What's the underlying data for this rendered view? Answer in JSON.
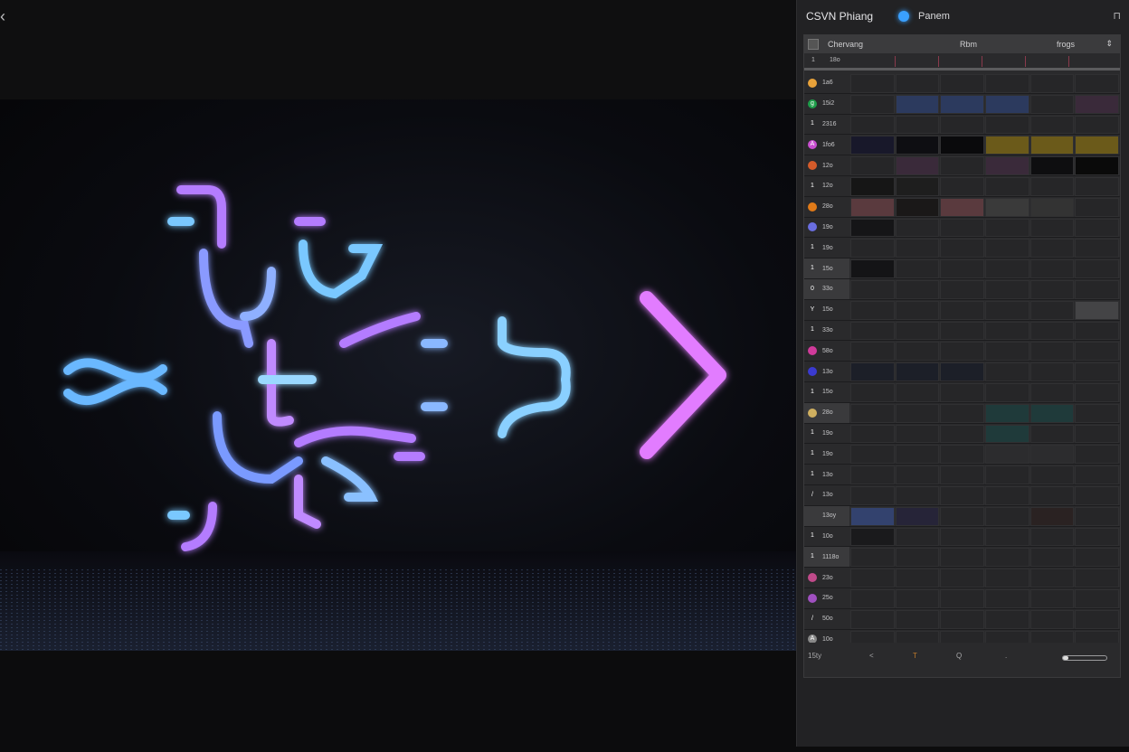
{
  "nav": {
    "back_icon": "chevron-left-icon",
    "back_glyph": "‹"
  },
  "viewer": {
    "image_alt": ""
  },
  "panel": {
    "title": "CSVN Phiang",
    "tab_label": "Panem",
    "close_glyph": "⊓",
    "grid_header": {
      "col1": "Chervang",
      "col2": "Rbm",
      "col3": "frogs",
      "sort_glyph": "⇕"
    },
    "scale_row": {
      "num": "1",
      "label": "18o"
    },
    "rows": [
      {
        "label": "1a6",
        "icon": "",
        "color": "#e8a23a",
        "alt": false
      },
      {
        "label": "15i2",
        "icon": "g",
        "color": "#1e9e4a",
        "alt": false
      },
      {
        "label": "2316",
        "icon": "1",
        "color": "",
        "alt": false
      },
      {
        "label": "1fo6",
        "icon": "A",
        "color": "#c94fd0",
        "alt": false
      },
      {
        "label": "12o",
        "icon": "",
        "color": "#d45b2a",
        "alt": false
      },
      {
        "label": "12o",
        "icon": "1",
        "color": "",
        "alt": false
      },
      {
        "label": "28o",
        "icon": "",
        "color": "#e07a18",
        "alt": false
      },
      {
        "label": "19o",
        "icon": "",
        "color": "#6a6ee0",
        "alt": false
      },
      {
        "label": "19o",
        "icon": "1",
        "color": "",
        "alt": false
      },
      {
        "label": "15o",
        "icon": "1",
        "color": "",
        "alt": true
      },
      {
        "label": "33o",
        "icon": "0",
        "color": "",
        "alt": true
      },
      {
        "label": "15o",
        "icon": "Y",
        "color": "",
        "alt": false
      },
      {
        "label": "33o",
        "icon": "1",
        "color": "",
        "alt": false
      },
      {
        "label": "58o",
        "icon": "",
        "color": "#d03a9a",
        "alt": false
      },
      {
        "label": "13o",
        "icon": "",
        "color": "#3a3ad0",
        "alt": false
      },
      {
        "label": "15o",
        "icon": "1",
        "color": "",
        "alt": false
      },
      {
        "label": "28o",
        "icon": "",
        "color": "#d0b060",
        "alt": true
      },
      {
        "label": "19o",
        "icon": "1",
        "color": "",
        "alt": false
      },
      {
        "label": "19o",
        "icon": "1",
        "color": "",
        "alt": false
      },
      {
        "label": "13o",
        "icon": "1",
        "color": "",
        "alt": false
      },
      {
        "label": "13o",
        "icon": "/",
        "color": "",
        "alt": false
      },
      {
        "label": "13oy",
        "icon": "",
        "color": "",
        "alt": true
      },
      {
        "label": "10o",
        "icon": "1",
        "color": "",
        "alt": false
      },
      {
        "label": "1118o",
        "icon": "1",
        "color": "",
        "alt": true
      },
      {
        "label": "23o",
        "icon": "",
        "color": "#c04a8a",
        "alt": false
      },
      {
        "label": "25o",
        "icon": "",
        "color": "#a050c0",
        "alt": false
      },
      {
        "label": "50o",
        "icon": "/",
        "color": "",
        "alt": false
      },
      {
        "label": "10o",
        "icon": "A",
        "color": "#888",
        "alt": false
      }
    ],
    "footer": {
      "num": "15ty",
      "items": [
        "<",
        "T",
        "Q",
        "."
      ]
    }
  },
  "colors": {
    "cell_default": "#262628",
    "blue": "#2c3a5e",
    "yellow": "#6b5a1a",
    "teal": "#1f3a3a",
    "mauve": "#3a2a3a",
    "pink": "#5a3a3e"
  }
}
